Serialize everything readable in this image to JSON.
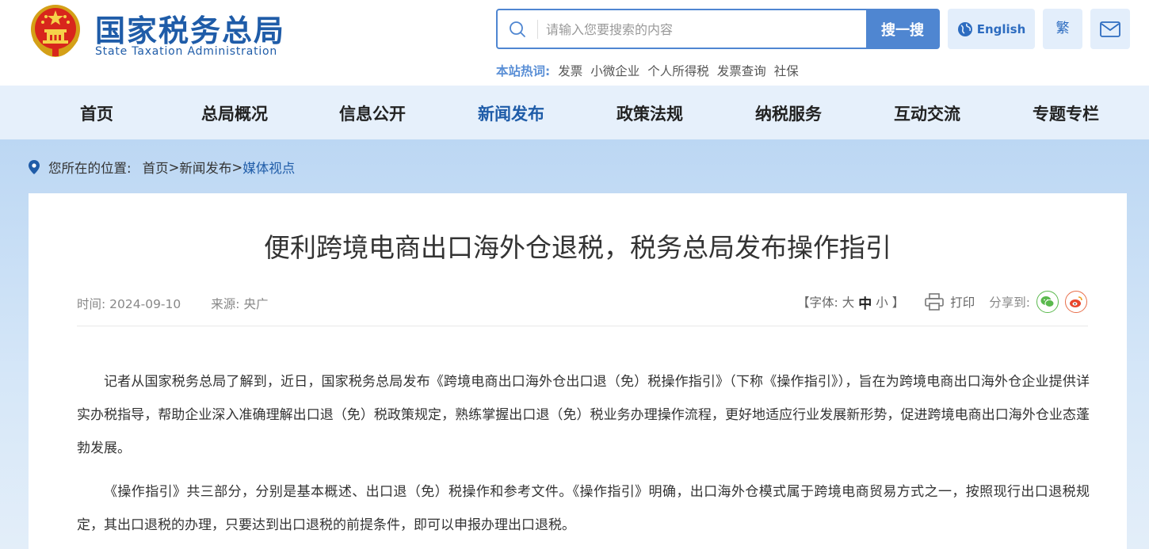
{
  "header": {
    "logo_cn": "国家税务总局",
    "logo_en": "State Taxation Administration",
    "search_placeholder": "请输入您要搜索的内容",
    "search_button": "搜一搜",
    "english_button": "English",
    "traditional_button": "繁",
    "hot_label": "本站热词:",
    "hot_words": [
      "发票",
      "小微企业",
      "个人所得税",
      "发票查询",
      "社保"
    ]
  },
  "nav": {
    "items": [
      "首页",
      "总局概况",
      "信息公开",
      "新闻发布",
      "政策法规",
      "纳税服务",
      "互动交流",
      "专题专栏"
    ],
    "active_index": 3
  },
  "breadcrumb": {
    "prefix": "您所在的位置:",
    "home": "首页",
    "sep": ">",
    "section": "新闻发布",
    "current": "媒体视点"
  },
  "article": {
    "title": "便利跨境电商出口海外仓退税，税务总局发布操作指引",
    "time_label": "时间:",
    "time": "2024-09-10",
    "source_label": "来源:",
    "source": "央广",
    "font_label": "【字体:",
    "font_large": "大",
    "font_mid": "中",
    "font_small": "小",
    "font_close": "】",
    "print_label": "打印",
    "share_label": "分享到:",
    "paragraphs": [
      "记者从国家税务总局了解到，近日，国家税务总局发布《跨境电商出口海外仓出口退（免）税操作指引》（下称《操作指引》），旨在为跨境电商出口海外仓企业提供详实办税指导，帮助企业深入准确理解出口退（免）税政策规定，熟练掌握出口退（免）税业务办理操作流程，更好地适应行业发展新形势，促进跨境电商出口海外仓业态蓬勃发展。",
      "《操作指引》共三部分，分别是基本概述、出口退（免）税操作和参考文件。《操作指引》明确，出口海外仓模式属于跨境电商贸易方式之一，按照现行出口退税规定，其出口退税的办理，只要达到出口退税的前提条件，即可以申报办理出口退税。"
    ]
  },
  "colors": {
    "brand_blue": "#1f5ca8",
    "search_blue": "#4f86d1",
    "nav_bg": "#e6f0fb",
    "band_bg": "#bcd7f3"
  }
}
